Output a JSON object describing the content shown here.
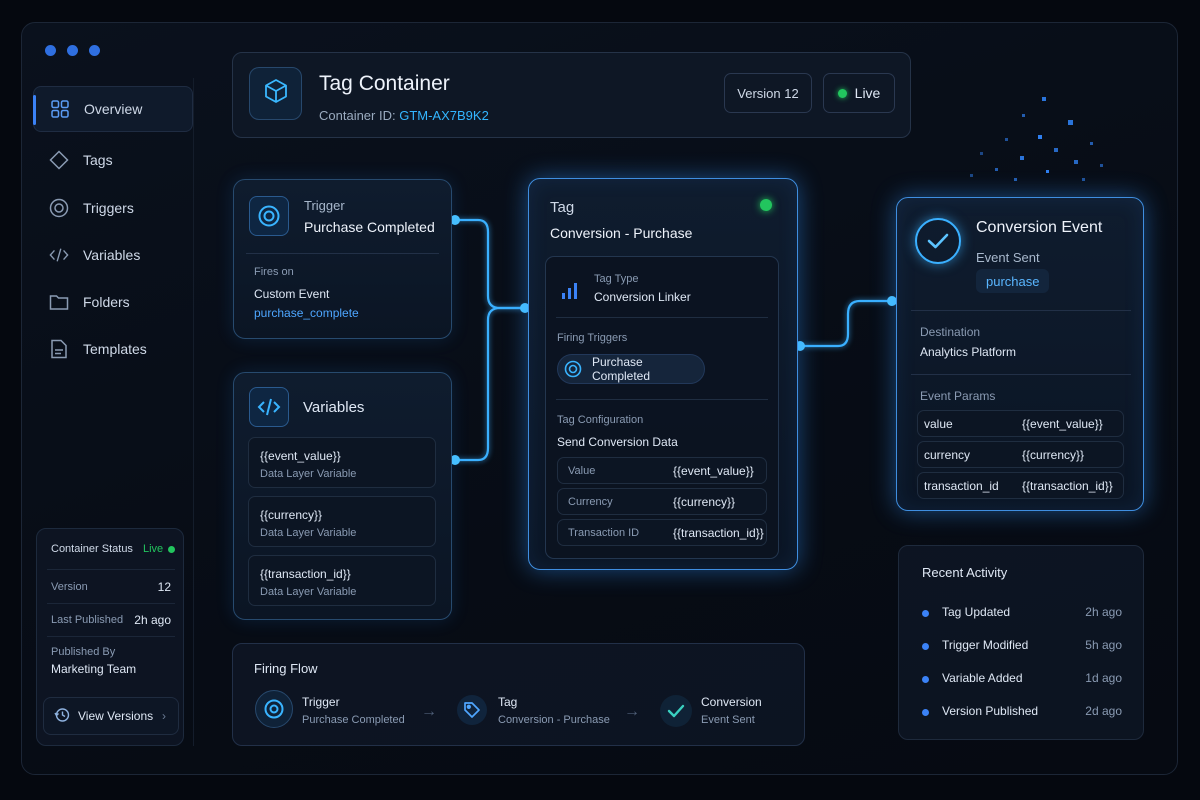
{
  "header": {
    "title": "Tag Container",
    "container_id_label": "Container ID:",
    "container_id": "GTM-AX7B9K2",
    "version_badge": "Version 12",
    "status_badge": "Live"
  },
  "sidebar": {
    "items": [
      {
        "label": "Overview",
        "icon": "grid-icon",
        "active": true
      },
      {
        "label": "Tags",
        "icon": "tag-icon"
      },
      {
        "label": "Triggers",
        "icon": "target-icon"
      },
      {
        "label": "Variables",
        "icon": "code-icon"
      },
      {
        "label": "Folders",
        "icon": "folder-icon"
      },
      {
        "label": "Templates",
        "icon": "document-icon"
      }
    ],
    "status": {
      "title": "Container Status",
      "live": "Live",
      "version_label": "Version",
      "version_value": "12",
      "published_label": "Last Published",
      "published_value": "2h ago",
      "by_label": "Published By",
      "by_value": "Marketing Team"
    },
    "view_versions": "View Versions"
  },
  "trigger_card": {
    "kind": "Trigger",
    "name": "Purchase Completed",
    "fires_on_label": "Fires on",
    "fires_on_value": "Custom Event",
    "event_name": "purchase_complete"
  },
  "variables_card": {
    "title": "Variables",
    "items": [
      {
        "name": "{{event_value}}",
        "type": "Data Layer Variable"
      },
      {
        "name": "{{currency}}",
        "type": "Data Layer Variable"
      },
      {
        "name": "{{transaction_id}}",
        "type": "Data Layer Variable"
      }
    ]
  },
  "tag_card": {
    "kind": "Tag",
    "name": "Conversion - Purchase",
    "tag_type_label": "Tag Type",
    "tag_type_value": "Conversion Linker",
    "firing_label": "Firing Triggers",
    "firing_value": "Purchase Completed",
    "config_label": "Tag Configuration",
    "config_value": "Send Conversion Data",
    "params": [
      {
        "key": "Value",
        "value": "{{event_value}}"
      },
      {
        "key": "Currency",
        "value": "{{currency}}"
      },
      {
        "key": "Transaction ID",
        "value": "{{transaction_id}}"
      }
    ],
    "status_color": "#22c55e"
  },
  "conversion_card": {
    "title": "Conversion Event",
    "subtitle": "Event Sent",
    "event_chip": "purchase",
    "destination_label": "Destination",
    "destination_value": "Analytics Platform",
    "params_label": "Event Params",
    "params": [
      {
        "key": "value",
        "value": "{{event_value}}"
      },
      {
        "key": "currency",
        "value": "{{currency}}"
      },
      {
        "key": "transaction_id",
        "value": "{{transaction_id}}"
      }
    ]
  },
  "firing_flow": {
    "title": "Firing Flow",
    "steps": [
      {
        "title": "Trigger",
        "sub": "Purchase Completed",
        "icon": "target-icon"
      },
      {
        "title": "Tag",
        "sub": "Conversion - Purchase",
        "icon": "tag-icon"
      },
      {
        "title": "Conversion",
        "sub": "Event Sent",
        "icon": "check-icon"
      }
    ]
  },
  "recent_activity": {
    "title": "Recent Activity",
    "items": [
      {
        "label": "Tag Updated",
        "time": "2h ago"
      },
      {
        "label": "Trigger Modified",
        "time": "5h ago"
      },
      {
        "label": "Variable Added",
        "time": "1d ago"
      },
      {
        "label": "Version Published",
        "time": "2d ago"
      }
    ]
  },
  "colors": {
    "accent": "#3b82f6",
    "glow": "#3fa0ff",
    "live": "#22c55e",
    "background": "#05080f"
  }
}
